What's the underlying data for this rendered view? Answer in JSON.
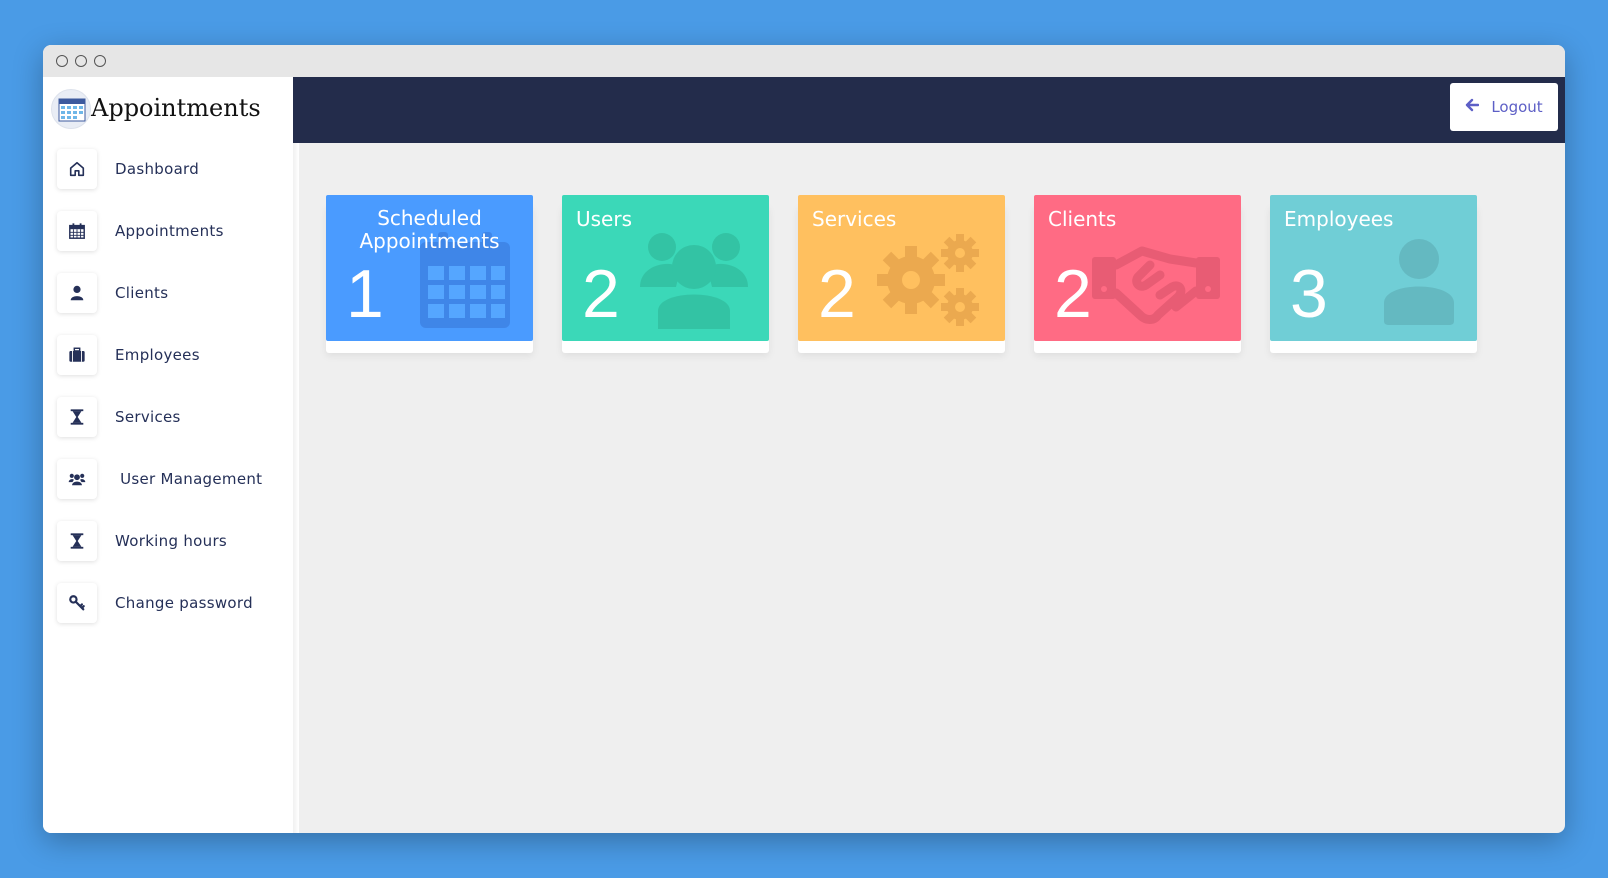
{
  "app": {
    "title": "Appointments"
  },
  "sidebar": {
    "items": [
      {
        "label": "Dashboard",
        "icon": "home-icon"
      },
      {
        "label": "Appointments",
        "icon": "calendar-icon"
      },
      {
        "label": "Clients",
        "icon": "user-icon"
      },
      {
        "label": "Employees",
        "icon": "briefcase-icon"
      },
      {
        "label": "Services",
        "icon": "hourglass-icon"
      },
      {
        "label": " User Management",
        "icon": "users-icon"
      },
      {
        "label": "Working hours",
        "icon": "hourglass-icon"
      },
      {
        "label": "Change password",
        "icon": "key-icon"
      }
    ]
  },
  "header": {
    "logout_label": "Logout",
    "logout_icon": "arrow-left-icon"
  },
  "cards": [
    {
      "title": "Scheduled Appointments",
      "count": "1",
      "color": "#4a9bff",
      "icon": "calendar-icon"
    },
    {
      "title": "Users",
      "count": "2",
      "color": "#3bd8b8",
      "icon": "users-icon"
    },
    {
      "title": "Services",
      "count": "2",
      "color": "#ffc05f",
      "icon": "gears-icon"
    },
    {
      "title": "Clients",
      "count": "2",
      "color": "#ff6b84",
      "icon": "handshake-icon"
    },
    {
      "title": "Employees",
      "count": "3",
      "color": "#70ced6",
      "icon": "user-icon"
    }
  ],
  "colors": {
    "topbar": "#232c4b",
    "nav_text": "#253058",
    "accent": "#5d5fc6"
  }
}
